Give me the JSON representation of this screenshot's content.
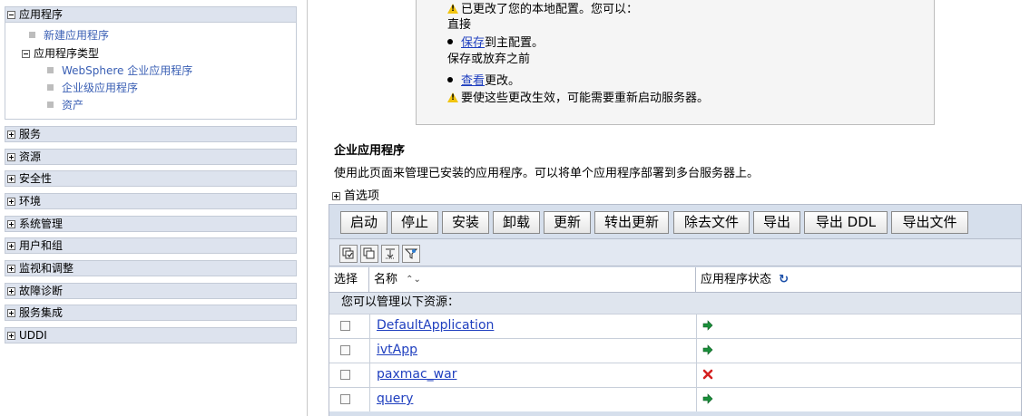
{
  "nav": {
    "applications": {
      "header": "应用程序",
      "new_app": "新建应用程序",
      "types_header": "应用程序类型",
      "types": [
        "WebSphere 企业应用程序",
        "企业级应用程序",
        "资产"
      ]
    },
    "sections": [
      "服务",
      "资源",
      "安全性",
      "环境",
      "系统管理",
      "用户和组",
      "监视和调整",
      "故障诊断",
      "服务集成",
      "UDDI"
    ]
  },
  "message": {
    "changed": "已更改了您的本地配置。您可以：",
    "direct": "直接",
    "save_link": "保存",
    "save_rest": "到主配置。",
    "review_before": "保存或放弃之前",
    "view_link": "查看",
    "view_rest": "更改。",
    "restart": "要使这些更改生效，可能需要重新启动服务器。"
  },
  "page": {
    "title": "企业应用程序",
    "description": "使用此页面来管理已安装的应用程序。可以将单个应用程序部署到多台服务器上。",
    "preferences": "首选项"
  },
  "toolbar": {
    "buttons": [
      "启动",
      "停止",
      "安装",
      "卸载",
      "更新",
      "转出更新",
      "除去文件",
      "导出",
      "导出 DDL",
      "导出文件"
    ]
  },
  "table": {
    "col_select": "选择",
    "col_name": "名称",
    "col_status": "应用程序状态",
    "resource_caption": "您可以管理以下资源：",
    "rows": [
      {
        "name": "DefaultApplication",
        "status": "started"
      },
      {
        "name": "ivtApp",
        "status": "started"
      },
      {
        "name": "paxmac_war",
        "status": "stopped"
      },
      {
        "name": "query",
        "status": "started"
      }
    ]
  },
  "colors": {
    "started": "#1a8f3a",
    "stopped": "#d42020",
    "nav_header_bg": "#dde3ee",
    "panel_bg": "#d6dfec"
  }
}
